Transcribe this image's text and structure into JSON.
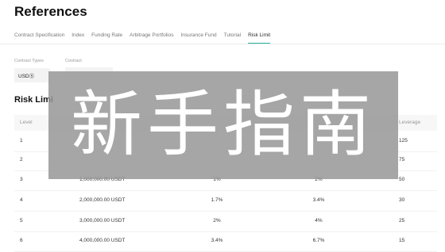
{
  "page": {
    "title": "References"
  },
  "tabs": [
    {
      "label": "Contract Specification"
    },
    {
      "label": "Index"
    },
    {
      "label": "Funding Rate"
    },
    {
      "label": "Arbitrage Portfolios"
    },
    {
      "label": "Insurance Fund"
    },
    {
      "label": "Tutorial"
    },
    {
      "label": "Risk Limit",
      "active": true
    }
  ],
  "filters": {
    "contract_types": {
      "label": "Contract Types",
      "value": "USDⓈ"
    },
    "contract": {
      "label": "Contract",
      "value": ""
    }
  },
  "section": {
    "title": "Risk Limi"
  },
  "table": {
    "headers": {
      "level": "Level",
      "leverage": "Leverage"
    },
    "rows": [
      {
        "level": "1",
        "amount": "",
        "imr": "",
        "mmr": "",
        "leverage": "125"
      },
      {
        "level": "2",
        "amount": "",
        "imr": "",
        "mmr": "",
        "leverage": "75"
      },
      {
        "level": "3",
        "amount": "1,000,000.00 USDT",
        "imr": "1%",
        "mmr": "2%",
        "leverage": "50"
      },
      {
        "level": "4",
        "amount": "2,000,000.00 USDT",
        "imr": "1.7%",
        "mmr": "3.4%",
        "leverage": "30"
      },
      {
        "level": "5",
        "amount": "3,000,000.00 USDT",
        "imr": "2%",
        "mmr": "4%",
        "leverage": "25"
      },
      {
        "level": "6",
        "amount": "4,000,000.00 USDT",
        "imr": "3.4%",
        "mmr": "6.7%",
        "leverage": "15"
      }
    ]
  },
  "overlay": {
    "text": "新手指南",
    "color": "#969696"
  }
}
